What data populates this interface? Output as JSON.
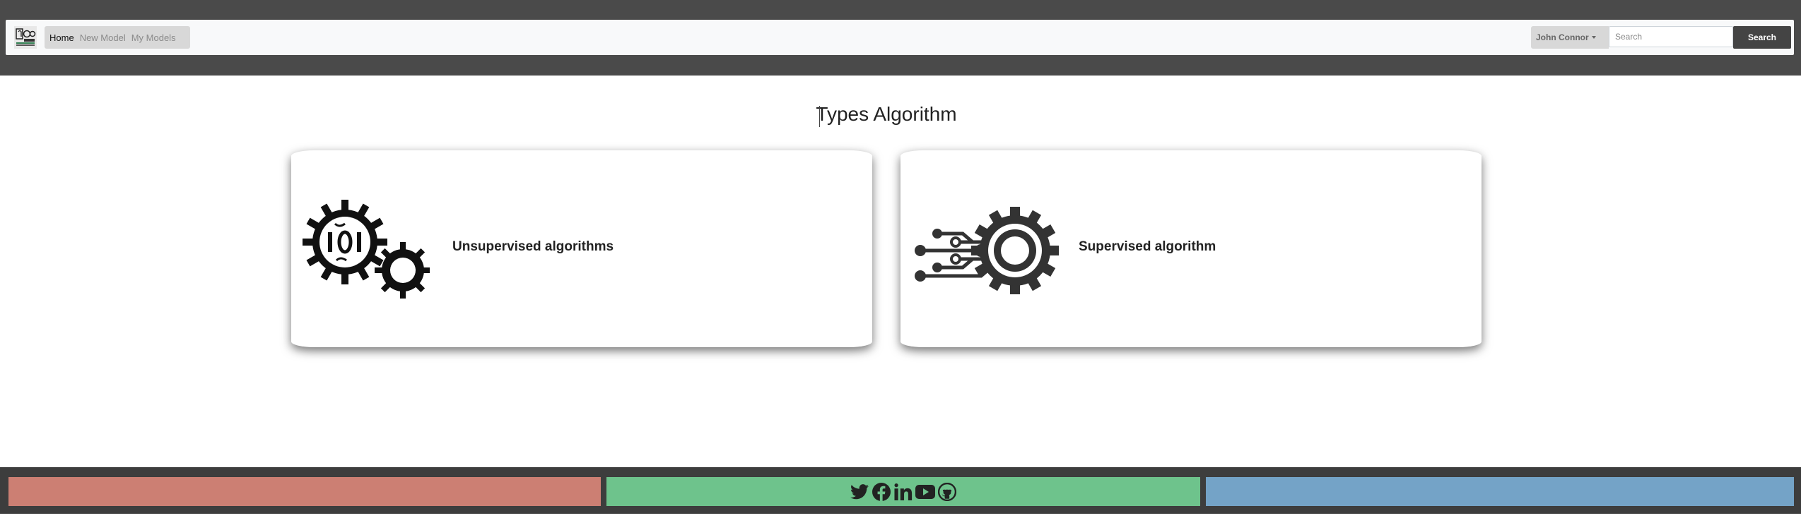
{
  "navbar": {
    "links": [
      {
        "label": "Home",
        "active": true
      },
      {
        "label": "New Model",
        "active": false
      },
      {
        "label": "My Models",
        "active": false
      }
    ],
    "user_name": "John Connor",
    "search_placeholder": "Search",
    "search_button": "Search"
  },
  "main": {
    "title": "Types Algorithm",
    "cards": [
      {
        "label": "Unsupervised algorithms",
        "icon": "gears-binary-icon"
      },
      {
        "label": "Supervised algorithm",
        "icon": "gear-circuit-icon"
      }
    ]
  },
  "footer": {
    "panel_colors": [
      "#cc7f73",
      "#6ec38c",
      "#74a3c7"
    ],
    "social_icons": [
      "twitter-icon",
      "facebook-icon",
      "linkedin-icon",
      "youtube-icon",
      "github-icon"
    ]
  },
  "colors": {
    "header_bg": "#4a4a4a",
    "navbar_bg": "#f8f9fa",
    "search_button_bg": "#444444",
    "footer_bg": "#3d3d3d"
  }
}
